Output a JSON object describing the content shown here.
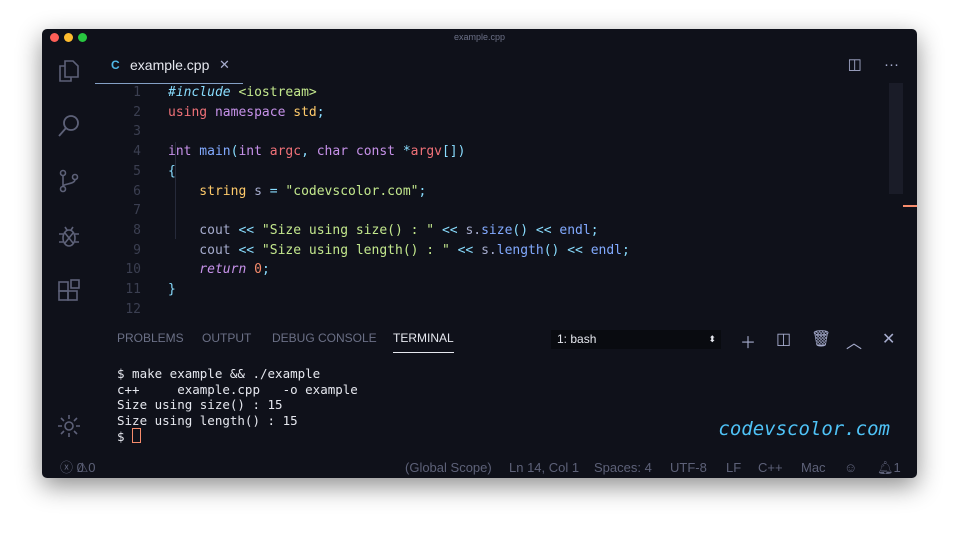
{
  "window": {
    "title": "example.cpp"
  },
  "tab": {
    "label": "example.cpp",
    "close": "✕"
  },
  "editor": {
    "lines": [
      [
        [
          "#include",
          "#89ddff",
          "i"
        ],
        [
          " <iostream>",
          "#c3e88d"
        ]
      ],
      [
        [
          "using",
          "#f07178"
        ],
        [
          " namespace",
          "#c792ea"
        ],
        [
          " std",
          "#ffcb6b"
        ],
        [
          ";",
          "#89ddff"
        ]
      ],
      [],
      [
        [
          "int",
          "#c792ea"
        ],
        [
          " main",
          "#82aaff"
        ],
        [
          "(",
          "#89ddff"
        ],
        [
          "int",
          "#c792ea"
        ],
        [
          " argc",
          "#f07178"
        ],
        [
          ", ",
          "#89ddff"
        ],
        [
          "char const",
          "#c792ea"
        ],
        [
          " *",
          "#89ddff"
        ],
        [
          "argv",
          "#f07178"
        ],
        [
          "[])",
          "#89ddff"
        ]
      ],
      [
        [
          "{",
          "#89ddff"
        ]
      ],
      [
        [
          "    string",
          "#ffcb6b"
        ],
        [
          " s ",
          "#a6accd"
        ],
        [
          "=",
          "#89ddff"
        ],
        [
          " \"codevscolor.com\"",
          "#c3e88d"
        ],
        [
          ";",
          "#89ddff"
        ]
      ],
      [],
      [
        [
          "    cout ",
          "#a6accd"
        ],
        [
          "<<",
          "#89ddff"
        ],
        [
          " \"Size using size() : \"",
          "#c3e88d"
        ],
        [
          " << ",
          "#89ddff"
        ],
        [
          "s.",
          "#a6accd"
        ],
        [
          "size",
          "#82aaff"
        ],
        [
          "()",
          "#89ddff"
        ],
        [
          " << ",
          "#89ddff"
        ],
        [
          "endl",
          "#82aaff"
        ],
        [
          ";",
          "#89ddff"
        ]
      ],
      [
        [
          "    cout ",
          "#a6accd"
        ],
        [
          "<<",
          "#89ddff"
        ],
        [
          " \"Size using length() : \"",
          "#c3e88d"
        ],
        [
          " << ",
          "#89ddff"
        ],
        [
          "s.",
          "#a6accd"
        ],
        [
          "length",
          "#82aaff"
        ],
        [
          "()",
          "#89ddff"
        ],
        [
          " << ",
          "#89ddff"
        ],
        [
          "endl",
          "#82aaff"
        ],
        [
          ";",
          "#89ddff"
        ]
      ],
      [
        [
          "    return",
          "#c792ea",
          "i"
        ],
        [
          " 0",
          "#f78c6c"
        ],
        [
          ";",
          "#89ddff"
        ]
      ],
      [
        [
          "}",
          "#89ddff"
        ]
      ],
      []
    ]
  },
  "panel": {
    "tabs": [
      "PROBLEMS",
      "OUTPUT",
      "DEBUG CONSOLE",
      "TERMINAL"
    ],
    "active": "TERMINAL",
    "terminal_select": "1: bash",
    "terminal_lines": [
      "$ make example && ./example",
      "c++     example.cpp   -o example",
      "Size using size() : 15",
      "Size using length() : 15",
      "$ "
    ]
  },
  "watermark": "codevscolor.com",
  "status": {
    "errors": "0",
    "warnings": "0",
    "scope": "(Global Scope)",
    "position": "Ln 14, Col 1",
    "spaces": "Spaces: 4",
    "encoding": "UTF-8",
    "eol": "LF",
    "language": "C++",
    "platform": "Mac",
    "notifications": "1"
  }
}
